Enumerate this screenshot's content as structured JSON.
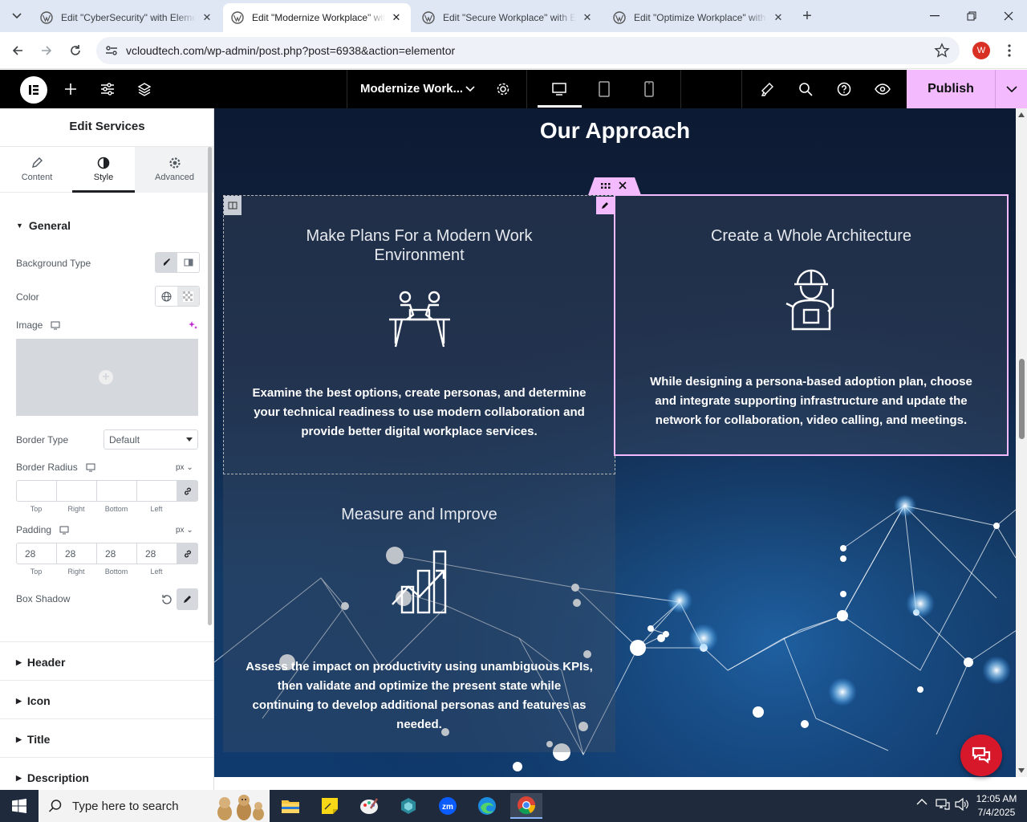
{
  "browser": {
    "tabs": [
      {
        "title": "Edit \"CyberSecurity\" with Elementor",
        "active": false
      },
      {
        "title": "Edit \"Modernize Workplace\" with Elementor",
        "active": true
      },
      {
        "title": "Edit \"Secure Workplace\" with Elementor",
        "active": false
      },
      {
        "title": "Edit \"Optimize Workplace\" with Elementor",
        "active": false
      }
    ],
    "url": "vcloudtech.com/wp-admin/post.php?post=6938&action=elementor",
    "profile_initial": "W"
  },
  "editor": {
    "page_name": "Modernize Work...",
    "publish_label": "Publish"
  },
  "panel": {
    "title": "Edit Services",
    "tabs": [
      {
        "label": "Content",
        "icon": "pencil-icon"
      },
      {
        "label": "Style",
        "icon": "contrast-icon"
      },
      {
        "label": "Advanced",
        "icon": "gear-icon"
      }
    ],
    "general": {
      "heading": "General",
      "background_type_label": "Background Type",
      "color_label": "Color",
      "image_label": "Image",
      "border_type_label": "Border Type",
      "border_type_value": "Default",
      "border_radius_label": "Border Radius",
      "border_radius_unit": "px",
      "border_radius": {
        "top": "",
        "right": "",
        "bottom": "",
        "left": ""
      },
      "padding_label": "Padding",
      "padding_unit": "px",
      "padding": {
        "top": "28",
        "right": "28",
        "bottom": "28",
        "left": "28"
      },
      "dim_labels": [
        "Top",
        "Right",
        "Bottom",
        "Left"
      ],
      "box_shadow_label": "Box Shadow"
    },
    "sections": [
      "Header",
      "Icon",
      "Title",
      "Description"
    ]
  },
  "canvas": {
    "heading": "Our Approach",
    "cards": [
      {
        "title": "Make Plans For a Modern Work Environment",
        "icon": "meeting-icon",
        "text": "Examine the best options, create personas, and determine your technical readiness to use modern collaboration and provide better digital workplace services."
      },
      {
        "title": "Create a Whole Architecture",
        "icon": "engineer-icon",
        "text": "While designing a persona-based adoption plan, choose and integrate supporting infrastructure and update the network for collaboration, video calling, and meetings."
      },
      {
        "title": "Measure and Improve",
        "icon": "growth-chart-icon",
        "text": "Assess the impact on productivity using unambiguous KPIs, then validate and optimize the present state while continuing to develop additional personas and features as needed."
      }
    ]
  },
  "taskbar": {
    "search_placeholder": "Type here to search",
    "time": "12:05 AM",
    "date": "7/4/2025"
  },
  "colors": {
    "publish_bg": "#f3bafd",
    "editor_bar": "#000000",
    "chat_button": "#d6182a",
    "canvas_bg": "#102444"
  }
}
